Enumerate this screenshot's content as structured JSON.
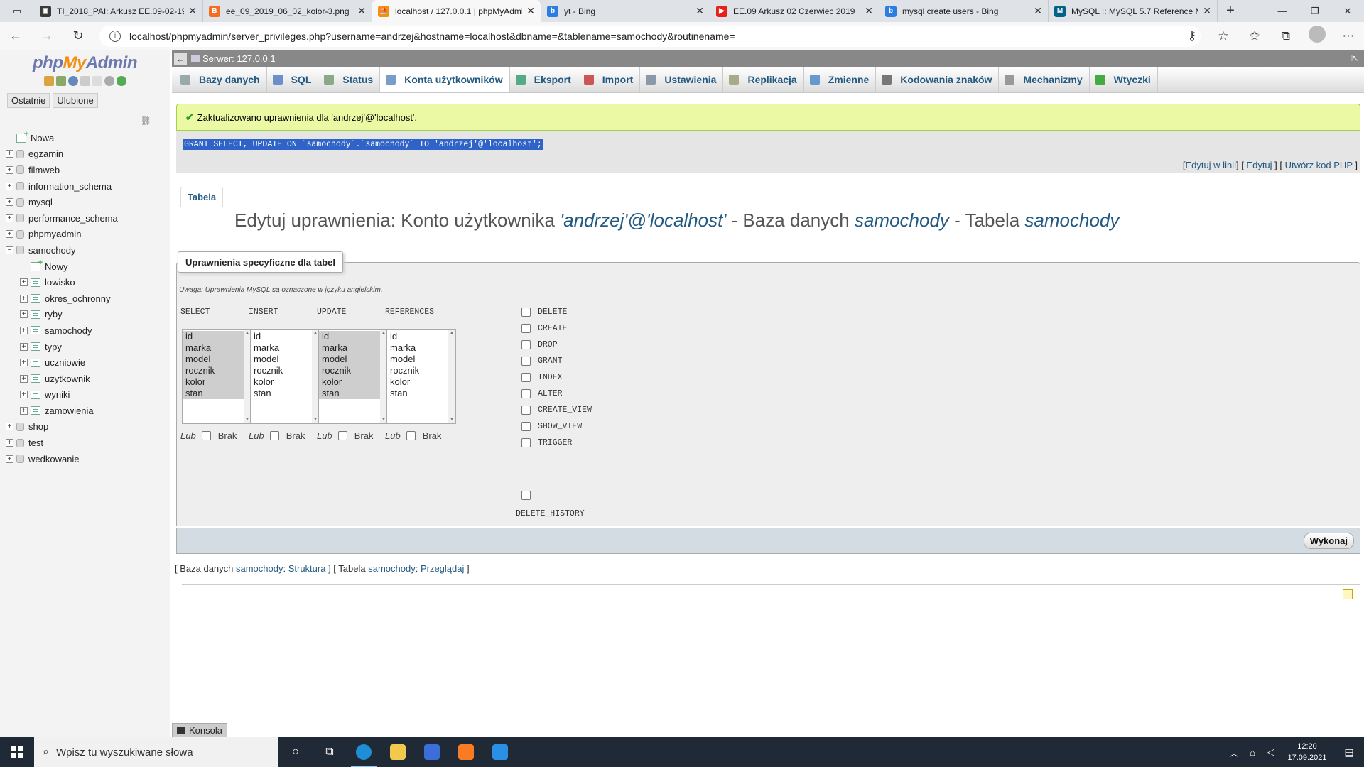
{
  "browser": {
    "tabs": [
      {
        "title": "TI_2018_PAI: Arkusz EE.09-02-19",
        "fav_color": "#3a3a3a",
        "fav_glyph": "▣"
      },
      {
        "title": "ee_09_2019_06_02_kolor-3.png",
        "fav_color": "#f26f21",
        "fav_glyph": "B"
      },
      {
        "title": "localhost / 127.0.0.1 | phpMyAdmin",
        "fav_color": "#f29111",
        "fav_glyph": "⛵",
        "active": true
      },
      {
        "title": "yt - Bing",
        "fav_color": "#2a7de1",
        "fav_glyph": "b"
      },
      {
        "title": "EE.09 Arkusz 02 Czerwiec 2019",
        "fav_color": "#e62117",
        "fav_glyph": "▶"
      },
      {
        "title": "mysql create users - Bing",
        "fav_color": "#2a7de1",
        "fav_glyph": "b"
      },
      {
        "title": "MySQL :: MySQL 5.7 Reference M",
        "fav_color": "#00618a",
        "fav_glyph": "M"
      }
    ],
    "url": "localhost/phpmyadmin/server_privileges.php?username=andrzej&hostname=localhost&dbname=&tablename=samochody&routinename="
  },
  "sidebar": {
    "logo": {
      "php": "php",
      "my": "My",
      "admin": "Admin"
    },
    "recent_label": "Ostatnie",
    "favorites_label": "Ulubione",
    "tree": [
      {
        "label": "Nowa",
        "kind": "new",
        "level": 0
      },
      {
        "label": "egzamin",
        "kind": "db",
        "level": 0,
        "exp": "+"
      },
      {
        "label": "filmweb",
        "kind": "db",
        "level": 0,
        "exp": "+"
      },
      {
        "label": "information_schema",
        "kind": "db",
        "level": 0,
        "exp": "+"
      },
      {
        "label": "mysql",
        "kind": "db",
        "level": 0,
        "exp": "+"
      },
      {
        "label": "performance_schema",
        "kind": "db",
        "level": 0,
        "exp": "+"
      },
      {
        "label": "phpmyadmin",
        "kind": "db",
        "level": 0,
        "exp": "+"
      },
      {
        "label": "samochody",
        "kind": "db",
        "level": 0,
        "exp": "−"
      },
      {
        "label": "Nowy",
        "kind": "new",
        "level": 1
      },
      {
        "label": "lowisko",
        "kind": "table",
        "level": 1,
        "exp": "+"
      },
      {
        "label": "okres_ochronny",
        "kind": "table",
        "level": 1,
        "exp": "+"
      },
      {
        "label": "ryby",
        "kind": "table",
        "level": 1,
        "exp": "+"
      },
      {
        "label": "samochody",
        "kind": "table",
        "level": 1,
        "exp": "+"
      },
      {
        "label": "typy",
        "kind": "table",
        "level": 1,
        "exp": "+"
      },
      {
        "label": "uczniowie",
        "kind": "table",
        "level": 1,
        "exp": "+"
      },
      {
        "label": "uzytkownik",
        "kind": "table",
        "level": 1,
        "exp": "+"
      },
      {
        "label": "wyniki",
        "kind": "table",
        "level": 1,
        "exp": "+"
      },
      {
        "label": "zamowienia",
        "kind": "table",
        "level": 1,
        "exp": "+"
      },
      {
        "label": "shop",
        "kind": "db",
        "level": 0,
        "exp": "+"
      },
      {
        "label": "test",
        "kind": "db",
        "level": 0,
        "exp": "+"
      },
      {
        "label": "wedkowanie",
        "kind": "db",
        "level": 0,
        "exp": "+"
      }
    ]
  },
  "server_bar": {
    "label": "Serwer: 127.0.0.1"
  },
  "menu": [
    {
      "label": "Bazy danych",
      "icon_color": "#9aa"
    },
    {
      "label": "SQL",
      "icon_color": "#6a8fc9"
    },
    {
      "label": "Status",
      "icon_color": "#8a8"
    },
    {
      "label": "Konta użytkowników",
      "icon_color": "#7a9cc9",
      "active": true
    },
    {
      "label": "Eksport",
      "icon_color": "#5a8"
    },
    {
      "label": "Import",
      "icon_color": "#c55"
    },
    {
      "label": "Ustawienia",
      "icon_color": "#89a"
    },
    {
      "label": "Replikacja",
      "icon_color": "#aa8"
    },
    {
      "label": "Zmienne",
      "icon_color": "#69c"
    },
    {
      "label": "Kodowania znaków",
      "icon_color": "#777"
    },
    {
      "label": "Mechanizmy",
      "icon_color": "#999"
    },
    {
      "label": "Wtyczki",
      "icon_color": "#4a4"
    }
  ],
  "message": {
    "success": "Zaktualizowano uprawnienia dla 'andrzej'@'localhost'.",
    "sql": "GRANT SELECT, UPDATE ON `samochody`.`samochody` TO 'andrzej'@'localhost';",
    "links": {
      "inline": "Edytuj w linii",
      "edit": "Edytuj",
      "php": "Utwórz kod PHP"
    }
  },
  "subtab": "Tabela",
  "heading": {
    "prefix": "Edytuj uprawnienia: Konto użytkownika ",
    "user": "'andrzej'@'localhost'",
    "mid1": " - Baza danych ",
    "db": "samochody",
    "mid2": " - Tabela ",
    "table": "samochody"
  },
  "privileges": {
    "legend": "Uprawnienia specyficzne dla tabel",
    "note": "Uwaga: Uprawnienia MySQL są oznaczone w języku angielskim.",
    "columns_list": [
      "id",
      "marka",
      "model",
      "rocznik",
      "kolor",
      "stan"
    ],
    "column_groups": [
      {
        "name": "SELECT",
        "selected": true
      },
      {
        "name": "INSERT",
        "selected": false
      },
      {
        "name": "UPDATE",
        "selected": true
      },
      {
        "name": "REFERENCES",
        "selected": false
      }
    ],
    "lub": "Lub",
    "brak": "Brak",
    "checkboxes": [
      "DELETE",
      "CREATE",
      "DROP",
      "GRANT",
      "INDEX",
      "ALTER",
      "CREATE_VIEW",
      "SHOW_VIEW",
      "TRIGGER"
    ],
    "delete_history": "DELETE_HISTORY",
    "submit": "Wykonaj"
  },
  "bottom_links": {
    "open1": "[ Baza danych ",
    "db_link": "samochody",
    "colon1": ": ",
    "struct": "Struktura",
    "mid": " ] [ Tabela ",
    "tbl_link": "samochody",
    "colon2": ": ",
    "browse": "Przeglądaj",
    "close": " ]"
  },
  "console": "Konsola",
  "taskbar": {
    "search_placeholder": "Wpisz tu wyszukiwane słowa",
    "time": "12:20",
    "date": "17.09.2021"
  }
}
